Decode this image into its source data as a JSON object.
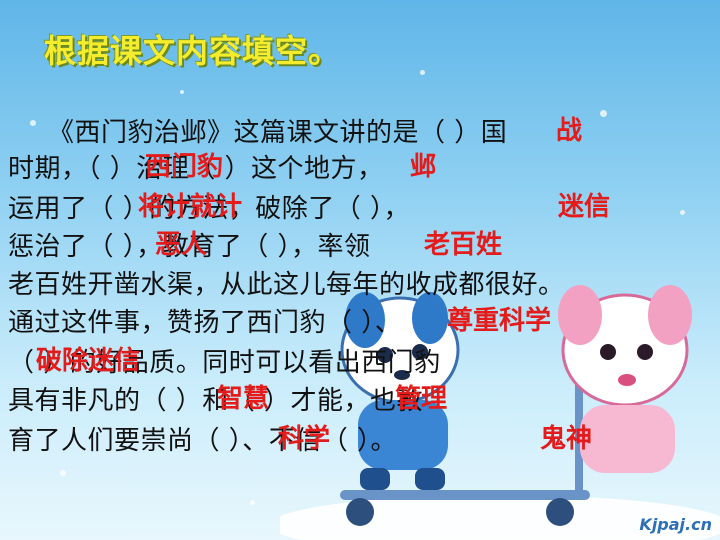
{
  "title": "根据课文内容填空。",
  "lines": [
    "《西门豹治邺》这篇课文讲的是（      ）国",
    "时期，（       ）治理（       ）这个地方，",
    "运用了（        ）的方法，破除了（        ），",
    "惩治了（        ），教育了（        ），率领",
    "老百姓开凿水渠，从此这儿每年的收成都很好。",
    "通过这件事，赞扬了西门豹（        ）、",
    "（        ）的好品质。同时可以看出西门豹",
    "具有非凡的（      ）和（       ）才能，也教",
    "育了人们要崇尚（      ）、不信（      ）。"
  ],
  "answers": [
    {
      "text": "战"
    },
    {
      "text": "西门豹"
    },
    {
      "text": "邺"
    },
    {
      "text": "将计就计"
    },
    {
      "text": "迷信"
    },
    {
      "text": "恶人"
    },
    {
      "text": "老百姓"
    },
    {
      "text": "尊重科学"
    },
    {
      "text": "破除迷信"
    },
    {
      "text": "智慧"
    },
    {
      "text": "管理"
    },
    {
      "text": "科学"
    },
    {
      "text": "鬼神"
    }
  ],
  "watermark": "Kjpaj.cn",
  "colors": {
    "title": "#f6ec2e",
    "answer": "#e31b1b",
    "body_text": "#111111"
  }
}
